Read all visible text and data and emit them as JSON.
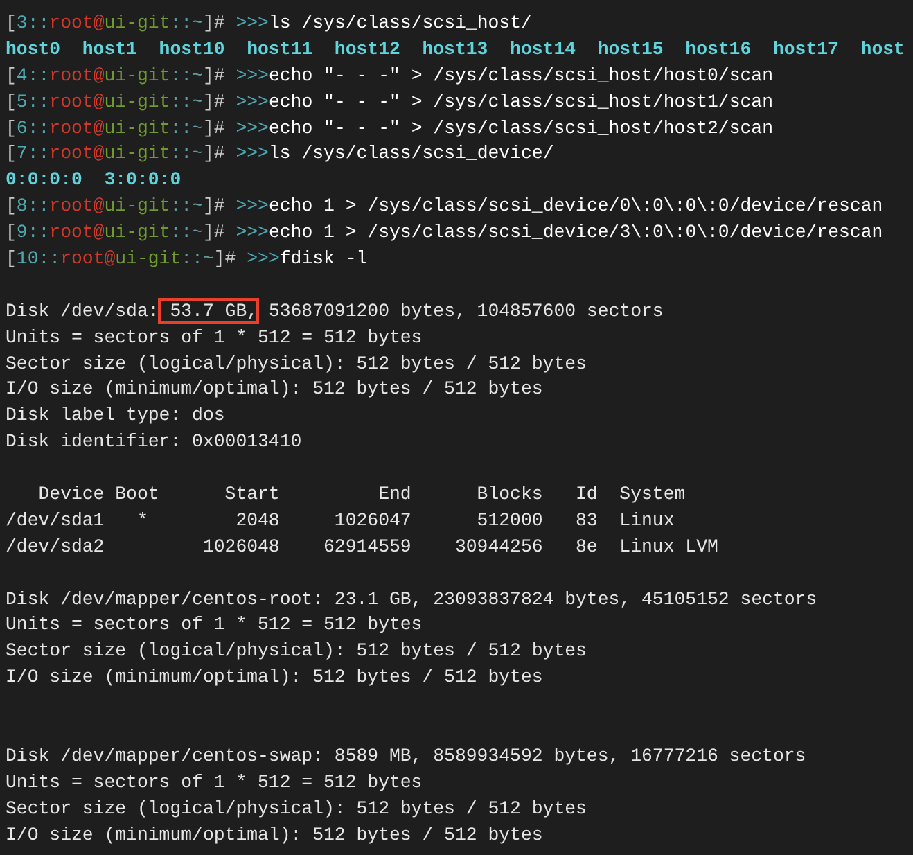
{
  "terminal": {
    "lines": [
      {
        "kind": "prompt",
        "prompt": [
          {
            "kind": "bracket",
            "text": "["
          },
          {
            "kind": "number",
            "text": "3::"
          },
          {
            "kind": "user",
            "text": "root@"
          },
          {
            "kind": "host",
            "text": "ui-git"
          },
          {
            "kind": "path",
            "text": "::~"
          },
          {
            "kind": "bracket",
            "text": "]#"
          },
          {
            "kind": "arrow",
            "text": " >>>"
          }
        ],
        "command": "ls /sys/class/scsi_host/"
      },
      {
        "kind": "listing",
        "text": "host0  host1  host10  host11  host12  host13  host14  host15  host16  host17  host"
      },
      {
        "kind": "prompt",
        "prompt": [
          {
            "kind": "bracket",
            "text": "["
          },
          {
            "kind": "number",
            "text": "4::"
          },
          {
            "kind": "user",
            "text": "root@"
          },
          {
            "kind": "host",
            "text": "ui-git"
          },
          {
            "kind": "path",
            "text": "::~"
          },
          {
            "kind": "bracket",
            "text": "]#"
          },
          {
            "kind": "arrow",
            "text": " >>>"
          }
        ],
        "command": "echo \"- - -\" > /sys/class/scsi_host/host0/scan"
      },
      {
        "kind": "prompt",
        "prompt": [
          {
            "kind": "bracket",
            "text": "["
          },
          {
            "kind": "number",
            "text": "5::"
          },
          {
            "kind": "user",
            "text": "root@"
          },
          {
            "kind": "host",
            "text": "ui-git"
          },
          {
            "kind": "path",
            "text": "::~"
          },
          {
            "kind": "bracket",
            "text": "]#"
          },
          {
            "kind": "arrow",
            "text": " >>>"
          }
        ],
        "command": "echo \"- - -\" > /sys/class/scsi_host/host1/scan"
      },
      {
        "kind": "prompt",
        "prompt": [
          {
            "kind": "bracket",
            "text": "["
          },
          {
            "kind": "number",
            "text": "6::"
          },
          {
            "kind": "user",
            "text": "root@"
          },
          {
            "kind": "host",
            "text": "ui-git"
          },
          {
            "kind": "path",
            "text": "::~"
          },
          {
            "kind": "bracket",
            "text": "]#"
          },
          {
            "kind": "arrow",
            "text": " >>>"
          }
        ],
        "command": "echo \"- - -\" > /sys/class/scsi_host/host2/scan"
      },
      {
        "kind": "prompt",
        "prompt": [
          {
            "kind": "bracket",
            "text": "["
          },
          {
            "kind": "number",
            "text": "7::"
          },
          {
            "kind": "user",
            "text": "root@"
          },
          {
            "kind": "host",
            "text": "ui-git"
          },
          {
            "kind": "path",
            "text": "::~"
          },
          {
            "kind": "bracket",
            "text": "]#"
          },
          {
            "kind": "arrow",
            "text": " >>>"
          }
        ],
        "command": "ls /sys/class/scsi_device/"
      },
      {
        "kind": "listing",
        "text": "0:0:0:0  3:0:0:0"
      },
      {
        "kind": "prompt",
        "prompt": [
          {
            "kind": "bracket",
            "text": "["
          },
          {
            "kind": "number",
            "text": "8::"
          },
          {
            "kind": "user",
            "text": "root@"
          },
          {
            "kind": "host",
            "text": "ui-git"
          },
          {
            "kind": "path",
            "text": "::~"
          },
          {
            "kind": "bracket",
            "text": "]#"
          },
          {
            "kind": "arrow",
            "text": " >>>"
          }
        ],
        "command": "echo 1 > /sys/class/scsi_device/0\\:0\\:0\\:0/device/rescan"
      },
      {
        "kind": "prompt",
        "prompt": [
          {
            "kind": "bracket",
            "text": "["
          },
          {
            "kind": "number",
            "text": "9::"
          },
          {
            "kind": "user",
            "text": "root@"
          },
          {
            "kind": "host",
            "text": "ui-git"
          },
          {
            "kind": "path",
            "text": "::~"
          },
          {
            "kind": "bracket",
            "text": "]#"
          },
          {
            "kind": "arrow",
            "text": " >>>"
          }
        ],
        "command": "echo 1 > /sys/class/scsi_device/3\\:0\\:0\\:0/device/rescan"
      },
      {
        "kind": "prompt",
        "prompt": [
          {
            "kind": "bracket",
            "text": "["
          },
          {
            "kind": "number",
            "text": "10::"
          },
          {
            "kind": "user",
            "text": "root@"
          },
          {
            "kind": "host",
            "text": "ui-git"
          },
          {
            "kind": "path",
            "text": "::~"
          },
          {
            "kind": "bracket",
            "text": "]#"
          },
          {
            "kind": "arrow",
            "text": " >>>"
          }
        ],
        "command": "fdisk -l"
      },
      {
        "kind": "blank"
      },
      {
        "kind": "output",
        "segments": [
          {
            "text": "Disk /dev/sda:",
            "highlighted": false
          },
          {
            "text": " 53.7 GB,",
            "highlighted": true
          },
          {
            "text": " 53687091200 bytes, 104857600 sectors",
            "highlighted": false
          }
        ]
      },
      {
        "kind": "output",
        "segments": [
          {
            "text": "Units = sectors of 1 * 512 = 512 bytes",
            "highlighted": false
          }
        ]
      },
      {
        "kind": "output",
        "segments": [
          {
            "text": "Sector size (logical/physical): 512 bytes / 512 bytes",
            "highlighted": false
          }
        ]
      },
      {
        "kind": "output",
        "segments": [
          {
            "text": "I/O size (minimum/optimal): 512 bytes / 512 bytes",
            "highlighted": false
          }
        ]
      },
      {
        "kind": "output",
        "segments": [
          {
            "text": "Disk label type: dos",
            "highlighted": false
          }
        ]
      },
      {
        "kind": "output",
        "segments": [
          {
            "text": "Disk identifier: 0x00013410",
            "highlighted": false
          }
        ]
      },
      {
        "kind": "blank"
      },
      {
        "kind": "output",
        "segments": [
          {
            "text": "   Device Boot      Start         End      Blocks   Id  System",
            "highlighted": false
          }
        ]
      },
      {
        "kind": "output",
        "segments": [
          {
            "text": "/dev/sda1   *        2048     1026047      512000   83  Linux",
            "highlighted": false
          }
        ]
      },
      {
        "kind": "output",
        "segments": [
          {
            "text": "/dev/sda2         1026048    62914559    30944256   8e  Linux LVM",
            "highlighted": false
          }
        ]
      },
      {
        "kind": "blank"
      },
      {
        "kind": "output",
        "segments": [
          {
            "text": "Disk /dev/mapper/centos-root: 23.1 GB, 23093837824 bytes, 45105152 sectors",
            "highlighted": false
          }
        ]
      },
      {
        "kind": "output",
        "segments": [
          {
            "text": "Units = sectors of 1 * 512 = 512 bytes",
            "highlighted": false
          }
        ]
      },
      {
        "kind": "output",
        "segments": [
          {
            "text": "Sector size (logical/physical): 512 bytes / 512 bytes",
            "highlighted": false
          }
        ]
      },
      {
        "kind": "output",
        "segments": [
          {
            "text": "I/O size (minimum/optimal): 512 bytes / 512 bytes",
            "highlighted": false
          }
        ]
      },
      {
        "kind": "blank"
      },
      {
        "kind": "blank"
      },
      {
        "kind": "output",
        "segments": [
          {
            "text": "Disk /dev/mapper/centos-swap: 8589 MB, 8589934592 bytes, 16777216 sectors",
            "highlighted": false
          }
        ]
      },
      {
        "kind": "output",
        "segments": [
          {
            "text": "Units = sectors of 1 * 512 = 512 bytes",
            "highlighted": false
          }
        ]
      },
      {
        "kind": "output",
        "segments": [
          {
            "text": "Sector size (logical/physical): 512 bytes / 512 bytes",
            "highlighted": false
          }
        ]
      },
      {
        "kind": "output",
        "segments": [
          {
            "text": "I/O size (minimum/optimal): 512 bytes / 512 bytes",
            "highlighted": false
          }
        ]
      }
    ]
  }
}
